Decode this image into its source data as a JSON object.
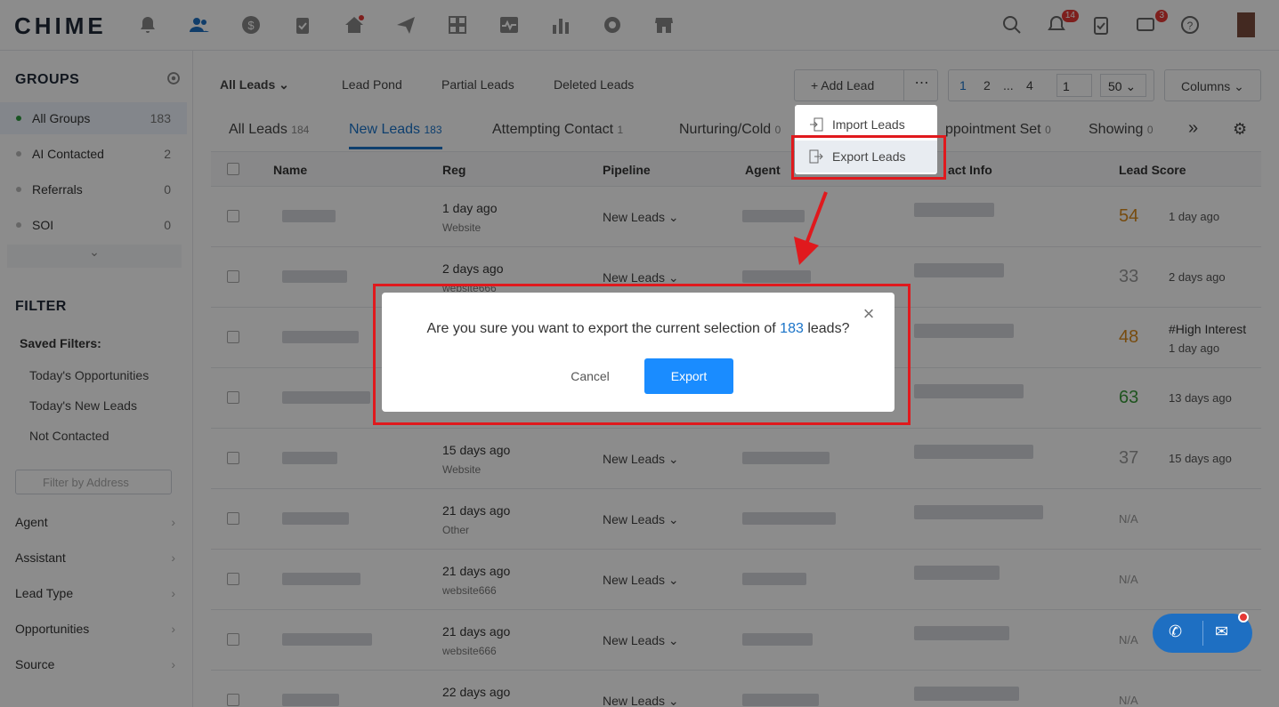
{
  "app": {
    "logo": "CHIME"
  },
  "header": {
    "notif_count": "14",
    "msg_count": "3"
  },
  "groups": {
    "title": "GROUPS",
    "items": [
      {
        "label": "All Groups",
        "count": "183"
      },
      {
        "label": "AI Contacted",
        "count": "2"
      },
      {
        "label": "Referrals",
        "count": "0"
      },
      {
        "label": "SOI",
        "count": "0"
      }
    ]
  },
  "filter": {
    "title": "FILTER",
    "saved_label": "Saved Filters:",
    "saved": [
      "Today's Opportunities",
      "Today's New Leads",
      "Not Contacted"
    ],
    "address_placeholder": "Filter by Address",
    "items": [
      "Agent",
      "Assistant",
      "Lead Type",
      "Opportunities",
      "Source"
    ]
  },
  "toolbar": {
    "view": "All Leads",
    "lead_pond": "Lead Pond",
    "partial_leads": "Partial Leads",
    "deleted_leads": "Deleted Leads",
    "add_lead": "Add Lead",
    "pages": [
      "1",
      "2",
      "...",
      "4"
    ],
    "page_input": "1",
    "page_size": "50",
    "columns": "Columns"
  },
  "stages": [
    {
      "label": "All Leads",
      "count": "184"
    },
    {
      "label": "New Leads",
      "count": "183"
    },
    {
      "label": "Attempting Contact",
      "count": "1"
    },
    {
      "label": "Nurturing/Cold",
      "count": "0"
    },
    {
      "label": "ppointment Set",
      "count": "0"
    },
    {
      "label": "Showing",
      "count": "0"
    }
  ],
  "table": {
    "headers": [
      "Name",
      "Reg",
      "Pipeline",
      "Agent",
      "act Info",
      "Lead Score"
    ],
    "rows": [
      {
        "reg": "1 day ago",
        "src": "Website",
        "pipeline": "New Leads",
        "score": "54",
        "score_note": "1 day ago",
        "color": "#d98a1c"
      },
      {
        "reg": "2 days ago",
        "src": "website666",
        "pipeline": "New Leads",
        "score": "33",
        "score_note": "2 days ago",
        "color": "#999999"
      },
      {
        "reg": "",
        "src": "",
        "pipeline": "",
        "score": "48",
        "score_note": "#High Interest",
        "score_note2": "1 day ago",
        "color": "#d98a1c"
      },
      {
        "reg": "",
        "src": "",
        "pipeline": "",
        "score": "63",
        "score_note": "13 days ago",
        "color": "#3a9a3a"
      },
      {
        "reg": "15 days ago",
        "src": "Website",
        "pipeline": "New Leads",
        "score": "37",
        "score_note": "15 days ago",
        "color": "#999999"
      },
      {
        "reg": "21 days ago",
        "src": "Other",
        "pipeline": "New Leads",
        "score": "N/A",
        "score_note": "",
        "color": "#999999"
      },
      {
        "reg": "21 days ago",
        "src": "website666",
        "pipeline": "New Leads",
        "score": "N/A",
        "score_note": "",
        "color": "#999999"
      },
      {
        "reg": "21 days ago",
        "src": "website666",
        "pipeline": "New Leads",
        "score": "N/A",
        "score_note": "",
        "color": "#999999"
      },
      {
        "reg": "22 days ago",
        "src": "",
        "pipeline": "New Leads",
        "score": "N/A",
        "score_note": "",
        "color": "#999999"
      }
    ]
  },
  "dropdown": {
    "import": "Import Leads",
    "export": "Export Leads"
  },
  "modal": {
    "msg_before": "Are you sure you want to export the current selection of",
    "count": "183",
    "msg_after": "leads?",
    "cancel": "Cancel",
    "export": "Export"
  },
  "colors": {
    "accent": "#1a8cff",
    "highlight": "#e0191d"
  }
}
